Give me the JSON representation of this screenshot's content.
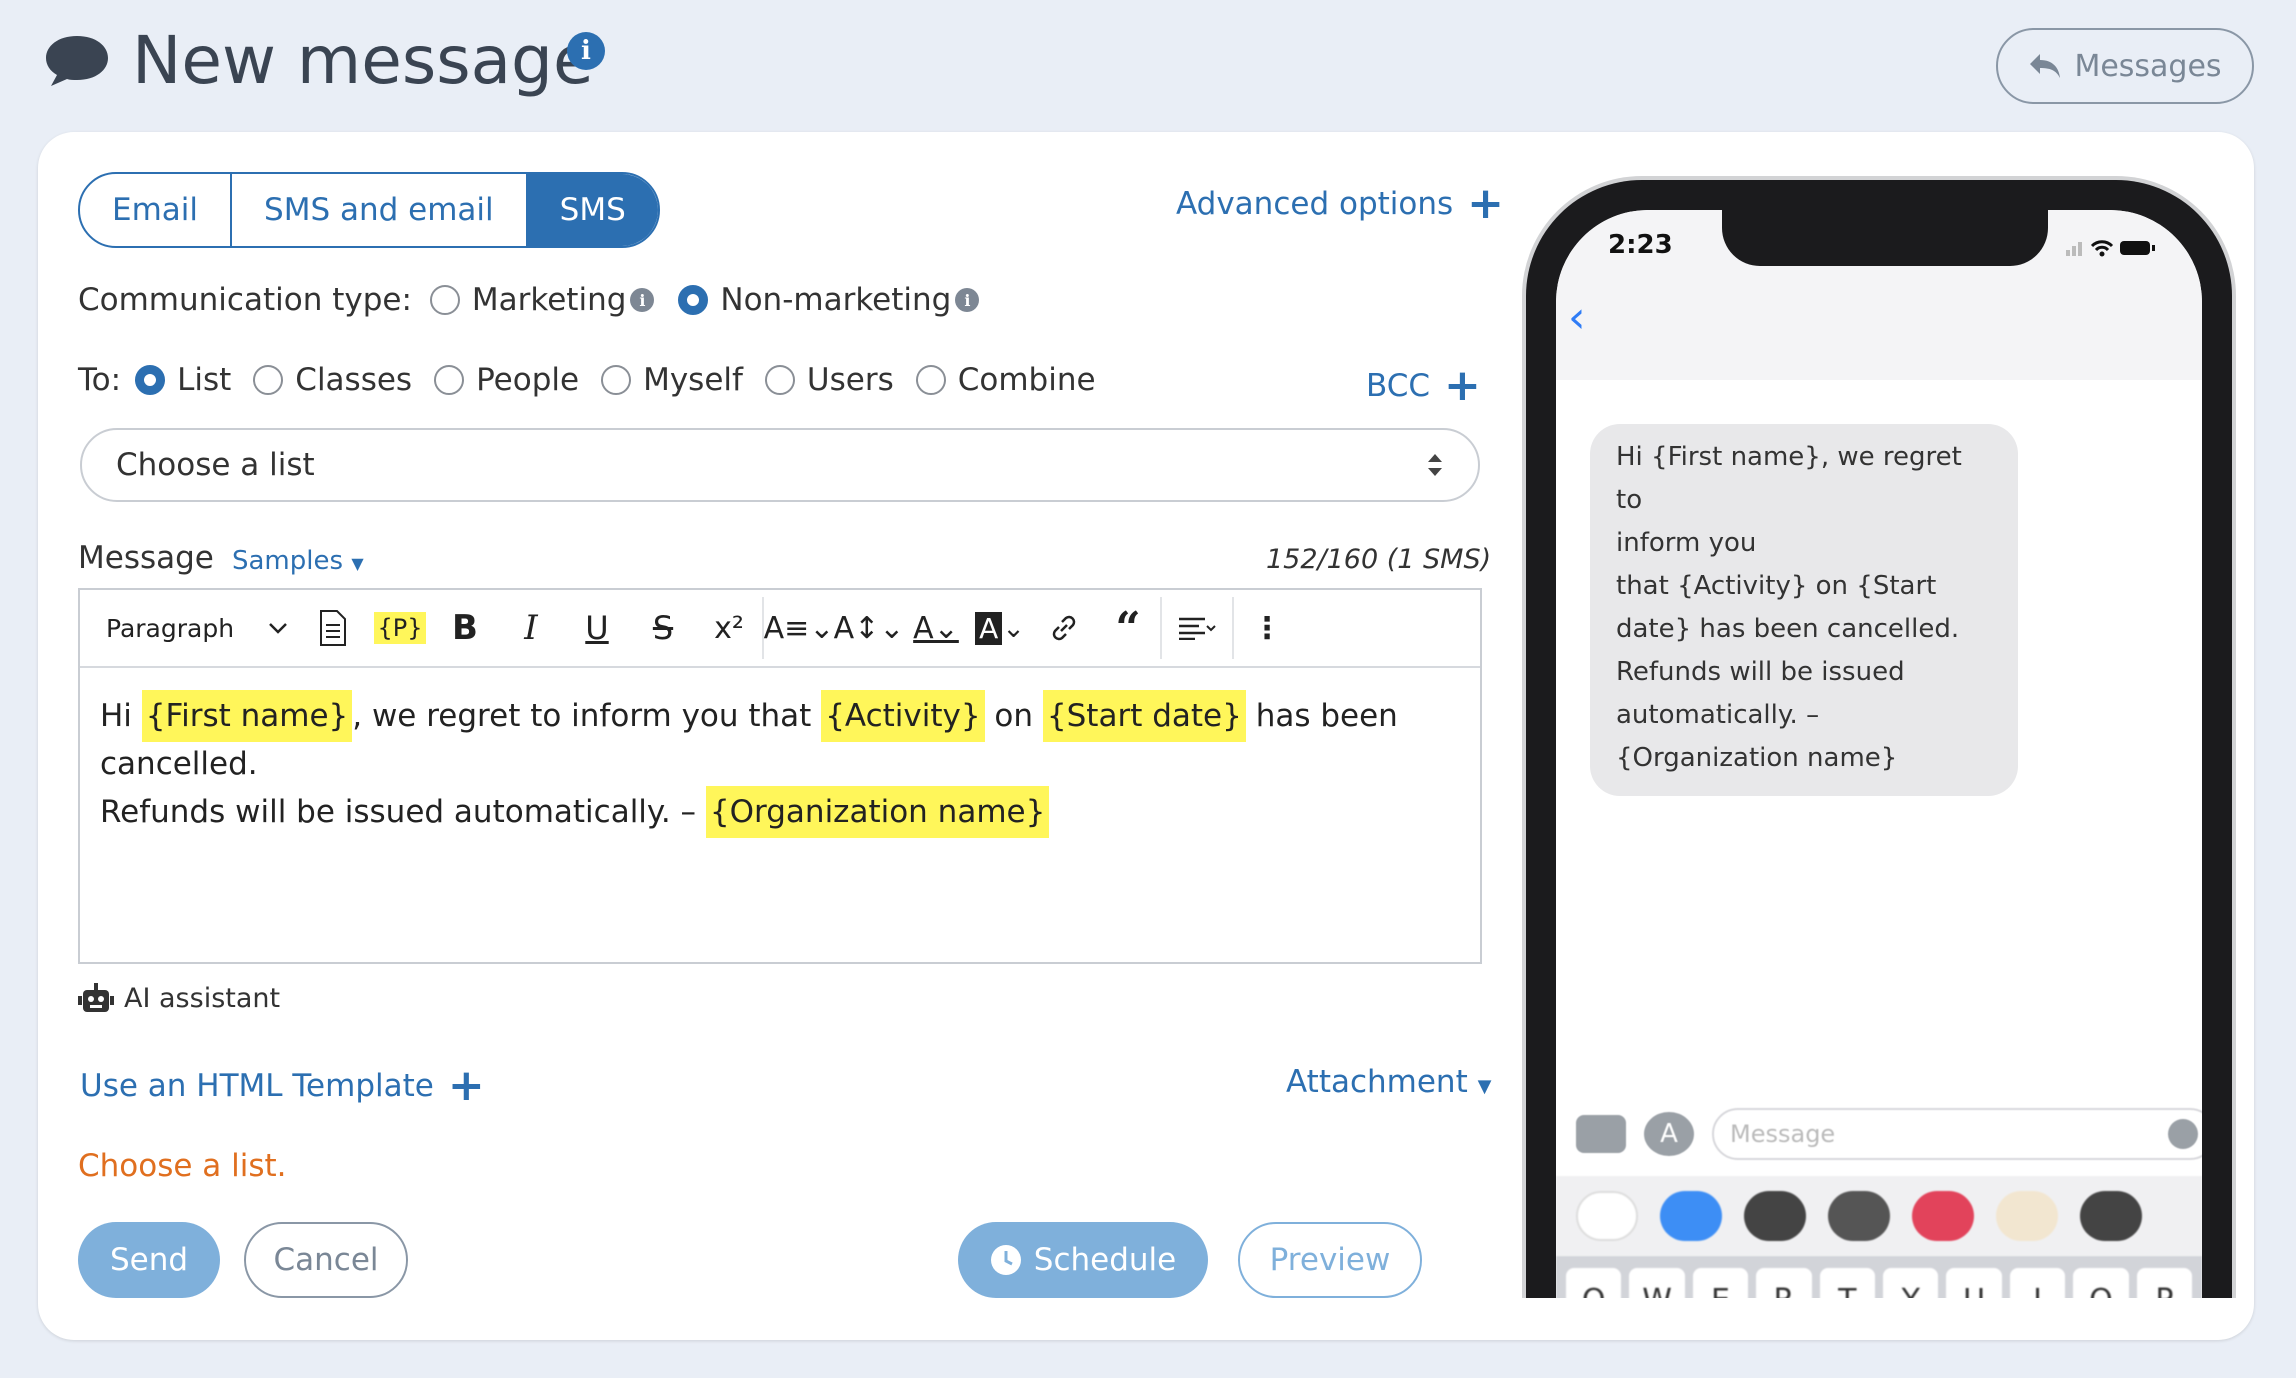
{
  "header": {
    "title": "New message",
    "messages_button": "Messages"
  },
  "tabs": [
    "Email",
    "SMS and email",
    "SMS"
  ],
  "active_tab": "SMS",
  "advanced_options": "Advanced options",
  "communication": {
    "label": "Communication type:",
    "options": [
      "Marketing",
      "Non-marketing"
    ],
    "selected": "Non-marketing"
  },
  "to": {
    "label": "To:",
    "options": [
      "List",
      "Classes",
      "People",
      "Myself",
      "Users",
      "Combine"
    ],
    "selected": "List",
    "bcc": "BCC"
  },
  "list_select": {
    "value": "Choose a list"
  },
  "message": {
    "label": "Message",
    "samples": "Samples",
    "counter": "152/160 (1 SMS)",
    "block_format": "Paragraph",
    "placeholder_tag": "{P}",
    "body": {
      "t1": "Hi ",
      "tag1": "{First name}",
      "t2": ", we regret to inform you that ",
      "tag2": "{Activity}",
      "t3": " on ",
      "tag3": "{Start date}",
      "t4": " has been cancelled.",
      "t5": "Refunds will be issued automatically. – ",
      "tag4": "{Organization name}"
    }
  },
  "ai_assistant": "AI assistant",
  "html_template": "Use an HTML Template",
  "attachment": "Attachment",
  "error": "Choose a list.",
  "buttons": {
    "send": "Send",
    "cancel": "Cancel",
    "schedule": "Schedule",
    "preview": "Preview"
  },
  "phone": {
    "time": "2:23",
    "bubble_lines": [
      "Hi {First name}, we regret to",
      "inform you",
      "that {Activity} on {Start",
      "date} has been cancelled.",
      "Refunds will be issued",
      "automatically. –",
      " {Organization name}"
    ],
    "input_placeholder": "Message",
    "keys": [
      "Q",
      "W",
      "E",
      "R",
      "T",
      "Y",
      "U",
      "I",
      "O",
      "P"
    ]
  },
  "colors": {
    "primary": "#2c6fb1",
    "button_light": "#7fb0db",
    "error": "#e06f1f",
    "highlight": "#fff65a",
    "background": "#e9eef6"
  }
}
